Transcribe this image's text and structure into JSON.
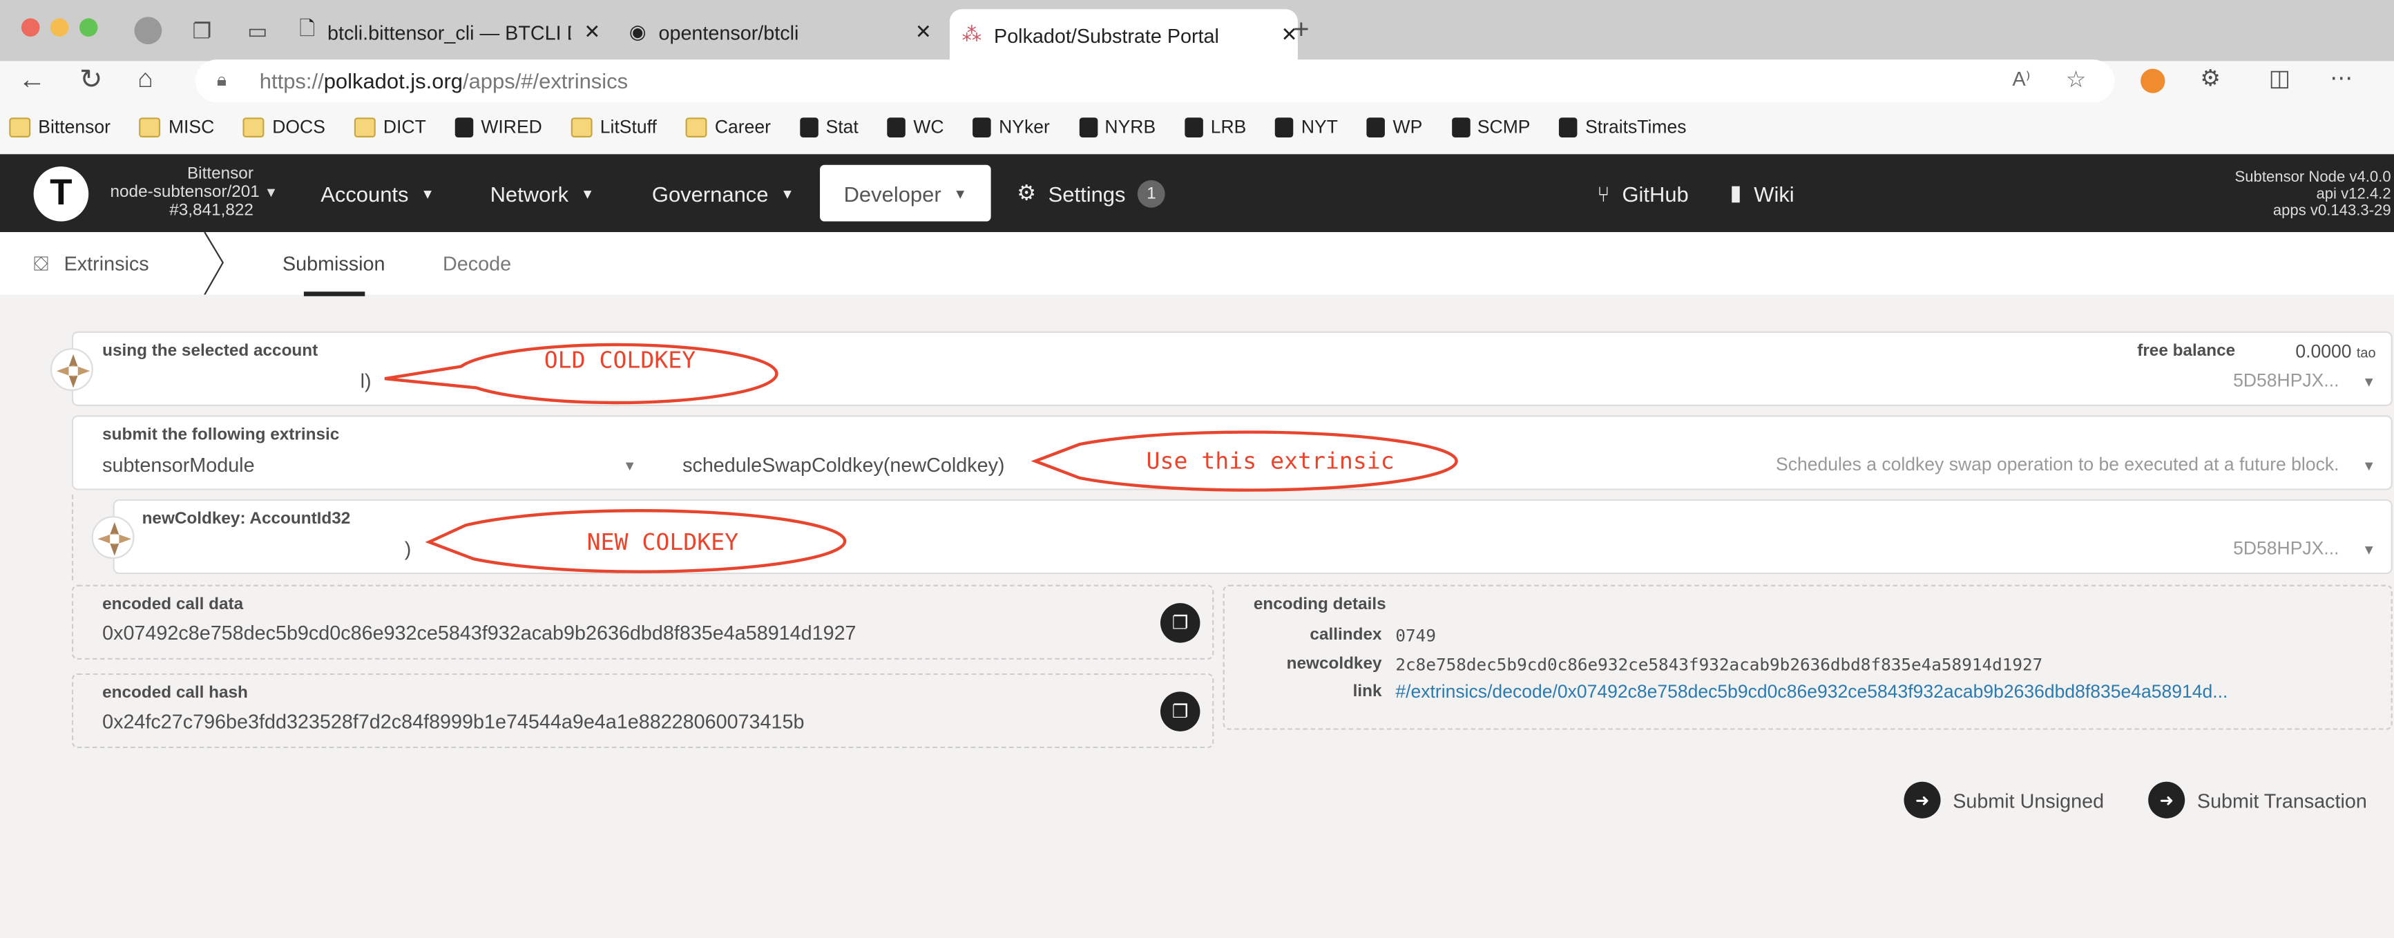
{
  "browser": {
    "tabs": [
      {
        "label": "btcli.bittensor_cli — BTCLI Docs",
        "icon": "document-icon"
      },
      {
        "label": "opentensor/btcli",
        "icon": "github-icon"
      },
      {
        "label": "Polkadot/Substrate Portal",
        "icon": "polkadot-icon",
        "active": true
      }
    ],
    "url_prefix": "https://",
    "url_host": "polkadot.js.org",
    "url_path": "/apps/#/extrinsics",
    "bookmarks": [
      "Bittensor",
      "MISC",
      "DOCS",
      "DICT",
      "WIRED",
      "LitStuff",
      "Career",
      "Stat",
      "WC",
      "NYker",
      "NYRB",
      "LRB",
      "NYT",
      "WP",
      "SCMP",
      "StraitsTimes"
    ]
  },
  "app": {
    "chain_name": "Bittensor",
    "node": "node-subtensor/201",
    "block": "#3,841,822",
    "nav": [
      "Accounts",
      "Network",
      "Governance",
      "Developer",
      "Settings"
    ],
    "settings_badge": "1",
    "github": "GitHub",
    "wiki": "Wiki",
    "version_node": "Subtensor Node v4.0.0",
    "version_api": "api v12.4.2",
    "version_apps": "apps v0.143.3-29",
    "section": "Extrinsics",
    "subtabs": [
      "Submission",
      "Decode"
    ]
  },
  "form": {
    "account_label": "using the selected account",
    "account_value": "l)",
    "free_balance_label": "free balance",
    "free_balance_value": "0.0000",
    "free_balance_unit": "tao",
    "account_address": "5D58HPJX...",
    "extrinsic_label": "submit the following extrinsic",
    "module": "subtensorModule",
    "method": "scheduleSwapColdkey(newColdkey)",
    "method_doc": "Schedules a coldkey swap operation to be executed at a future block.",
    "param_label": "newColdkey: AccountId32",
    "param_value": ")",
    "param_address": "5D58HPJX...",
    "call_data_label": "encoded call data",
    "call_data": "0x07492c8e758dec5b9cd0c86e932ce5843f932acab9b2636dbd8f835e4a58914d1927",
    "call_hash_label": "encoded call hash",
    "call_hash": "0x24fc27c796be3fdd323528f7d2c84f8999b1e74544a9e4a1e88228060073415b",
    "details_label": "encoding details",
    "callindex_label": "callindex",
    "callindex": "0749",
    "newcoldkey_label": "newcoldkey",
    "newcoldkey": "2c8e758dec5b9cd0c86e932ce5843f932acab9b2636dbd8f835e4a58914d1927",
    "link_label": "link",
    "link": "#/extrinsics/decode/0x07492c8e758dec5b9cd0c86e932ce5843f932acab9b2636dbd8f835e4a58914d...",
    "submit_unsigned": "Submit Unsigned",
    "submit_transaction": "Submit Transaction"
  },
  "annotations": {
    "old_coldkey": "OLD COLDKEY",
    "use_extrinsic": "Use this extrinsic",
    "new_coldkey": "NEW COLDKEY",
    "color": "#e8452e"
  }
}
